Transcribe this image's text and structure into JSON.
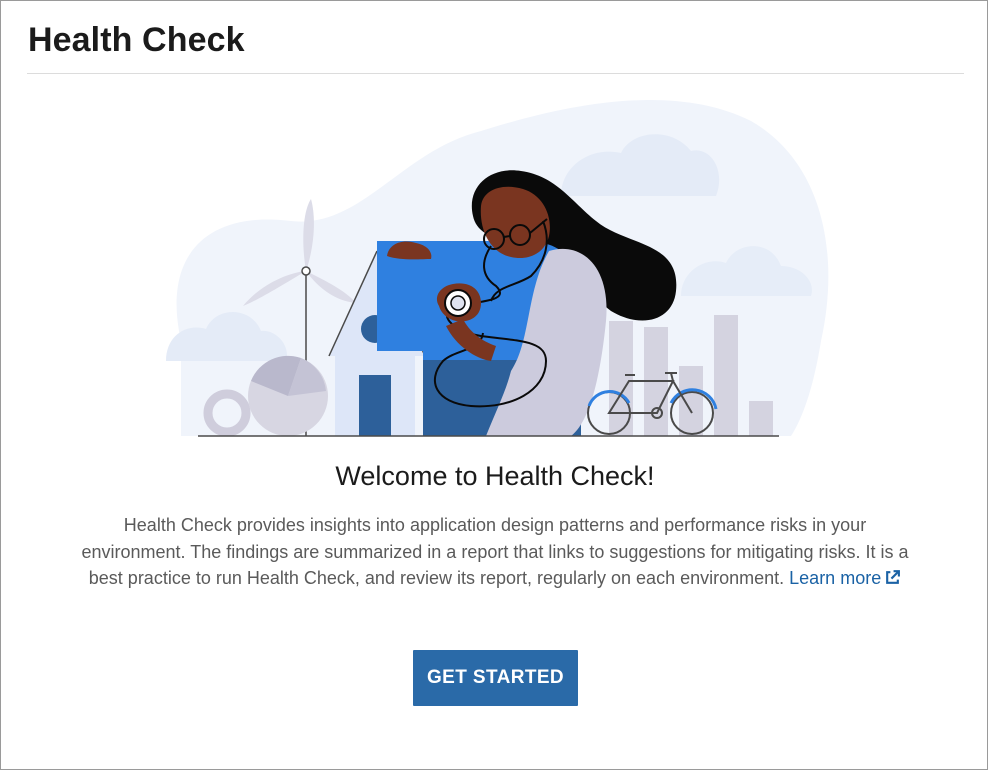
{
  "header": {
    "title": "Health Check"
  },
  "illustration": {
    "name": "health-check-illustration"
  },
  "welcome": {
    "title": "Welcome to Health Check!",
    "description": "Health Check provides insights into application design patterns and performance risks in your environment. The findings are summarized in a report that links to suggestions for mitigating risks. It is a best practice to run Health Check, and review its report, regularly on each environment.",
    "learn_more_label": "Learn more",
    "learn_more_icon": "external-link-icon"
  },
  "actions": {
    "get_started_label": "GET STARTED"
  },
  "colors": {
    "button_bg": "#2a6aa8",
    "link": "#1a62a5",
    "title_text": "#1b1b1b",
    "body_text": "#5a5a5a",
    "illustration_blue": "#2f80e0",
    "illustration_dark_blue": "#2d609a",
    "illustration_bg": "#f0f4fb",
    "illustration_gray": "#cfcddc"
  }
}
